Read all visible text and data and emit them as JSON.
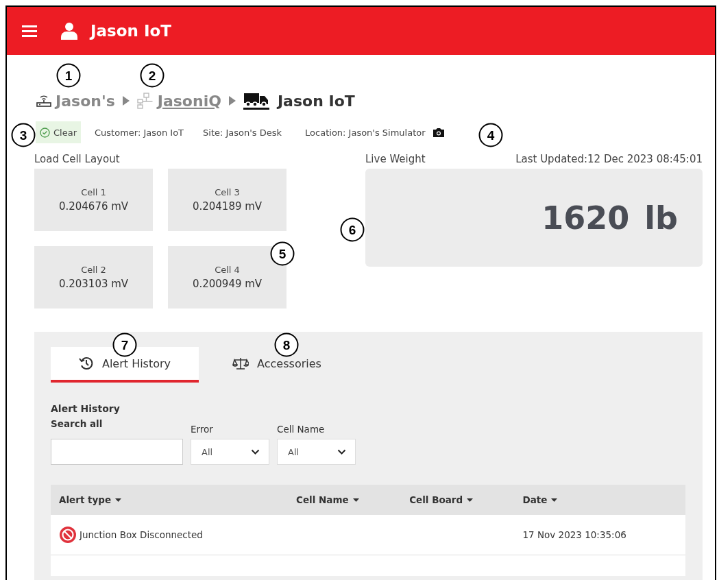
{
  "header": {
    "title": "Jason IoT"
  },
  "breadcrumb": [
    {
      "label": "Jason's",
      "kind": "router",
      "link": false
    },
    {
      "label": "JasoniQ",
      "kind": "network",
      "link": true
    },
    {
      "label": "Jason IoT",
      "kind": "truck",
      "link": false
    }
  ],
  "info": {
    "status": {
      "label": "Clear",
      "kind": "clear"
    },
    "customer": "Customer: Jason IoT",
    "site": "Site: Jason's Desk",
    "location": "Location: Jason's Simulator"
  },
  "load_cell_layout": {
    "title": "Load Cell Layout",
    "cells": [
      {
        "name": "Cell 1",
        "reading": "0.204676 mV"
      },
      {
        "name": "Cell 3",
        "reading": "0.204189 mV"
      },
      {
        "name": "Cell 2",
        "reading": "0.203103 mV"
      },
      {
        "name": "Cell 4",
        "reading": "0.200949 mV"
      }
    ]
  },
  "live_weight": {
    "title": "Live Weight",
    "last_updated": "Last Updated:12 Dec 2023 08:45:01",
    "value": "1620",
    "unit": "lb"
  },
  "tabs": [
    {
      "label": "Alert History",
      "kind": "history",
      "selected": true
    },
    {
      "label": "Accessories",
      "kind": "scale",
      "selected": false
    }
  ],
  "alert_history": {
    "title": "Alert History",
    "search": {
      "label": "Search all"
    },
    "filters": [
      {
        "label": "Error",
        "value": "All"
      },
      {
        "label": "Cell Name",
        "value": "All"
      }
    ],
    "table": {
      "columns": [
        "Alert type",
        "Cell Name",
        "Cell Board",
        "Date"
      ],
      "rows": [
        {
          "kind": "error",
          "alert_type": "Junction Box Disconnected",
          "date": "17 Nov 2023 10:35:06"
        }
      ]
    }
  },
  "callouts": [
    "1",
    "2",
    "3",
    "4",
    "5",
    "6",
    "7",
    "8"
  ]
}
